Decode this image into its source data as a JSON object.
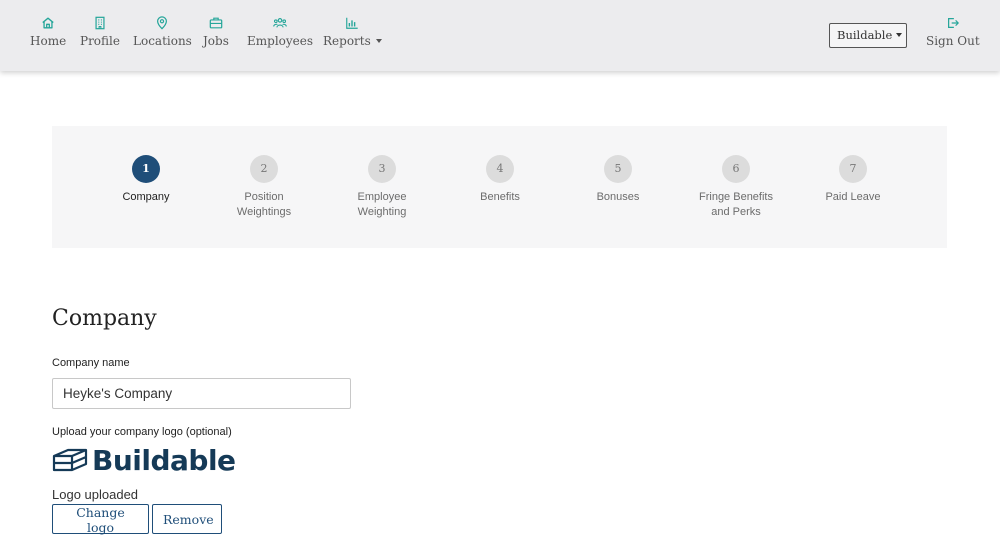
{
  "nav": {
    "home": "Home",
    "profile": "Profile",
    "locations": "Locations",
    "jobs": "Jobs",
    "employees": "Employees",
    "reports": "Reports",
    "company_selector": "Buildable",
    "sign_out": "Sign Out"
  },
  "colors": {
    "accent": "#1f4e79",
    "nav_icon": "#26a69a",
    "logo": "#153a57"
  },
  "stepper": {
    "steps": [
      {
        "number": "1",
        "label": "Company",
        "active": true
      },
      {
        "number": "2",
        "label": "Position Weightings"
      },
      {
        "number": "3",
        "label": "Employee Weighting"
      },
      {
        "number": "4",
        "label": "Benefits"
      },
      {
        "number": "5",
        "label": "Bonuses"
      },
      {
        "number": "6",
        "label": "Fringe Benefits and Perks"
      },
      {
        "number": "7",
        "label": "Paid Leave"
      }
    ]
  },
  "form": {
    "title": "Company",
    "company_name_label": "Company name",
    "company_name_value": "Heyke's Company",
    "logo_label": "Upload your company logo (optional)",
    "logo_text": "Buildable",
    "logo_status": "Logo uploaded",
    "change_logo": "Change logo",
    "remove": "Remove"
  }
}
